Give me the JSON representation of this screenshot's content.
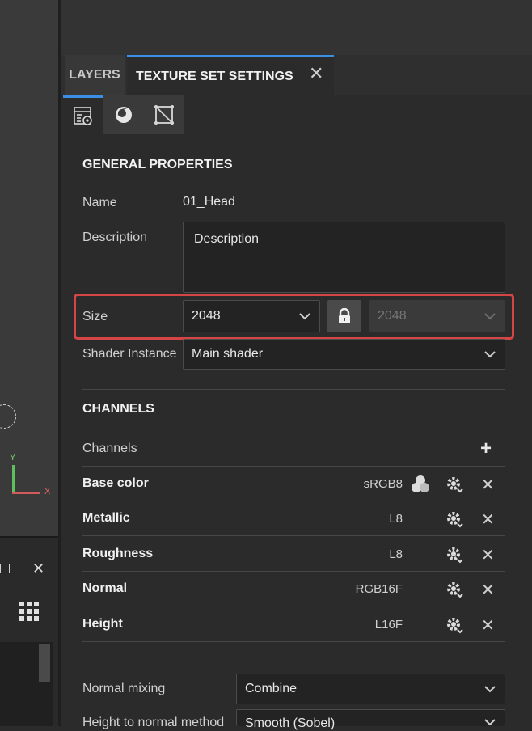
{
  "viewport": {
    "axis_y": "Y",
    "axis_x": "X"
  },
  "tabs": [
    {
      "label": "LAYERS"
    },
    {
      "label": "TEXTURE SET SETTINGS"
    }
  ],
  "icon_tabs": [
    "settings-list-icon",
    "material-sphere-icon",
    "uv-mesh-icon"
  ],
  "general": {
    "title": "GENERAL PROPERTIES",
    "name_label": "Name",
    "name_value": "01_Head",
    "description_label": "Description",
    "description_value": "Description",
    "size_label": "Size",
    "size_value": "2048",
    "size_value_locked": "2048",
    "shader_label": "Shader Instance",
    "shader_value": "Main shader"
  },
  "channels": {
    "title": "CHANNELS",
    "list_label": "Channels",
    "items": [
      {
        "name": "Base color",
        "format": "sRGB8"
      },
      {
        "name": "Metallic",
        "format": "L8"
      },
      {
        "name": "Roughness",
        "format": "L8"
      },
      {
        "name": "Normal",
        "format": "RGB16F"
      },
      {
        "name": "Height",
        "format": "L16F"
      }
    ]
  },
  "normal": {
    "mixing_label": "Normal mixing",
    "mixing_value": "Combine",
    "method_label": "Height to normal method",
    "method_value": "Smooth (Sobel)"
  },
  "colors": {
    "accent": "#3a8ee6",
    "highlight": "#d64545",
    "panel_bg": "#2b2b2b"
  }
}
